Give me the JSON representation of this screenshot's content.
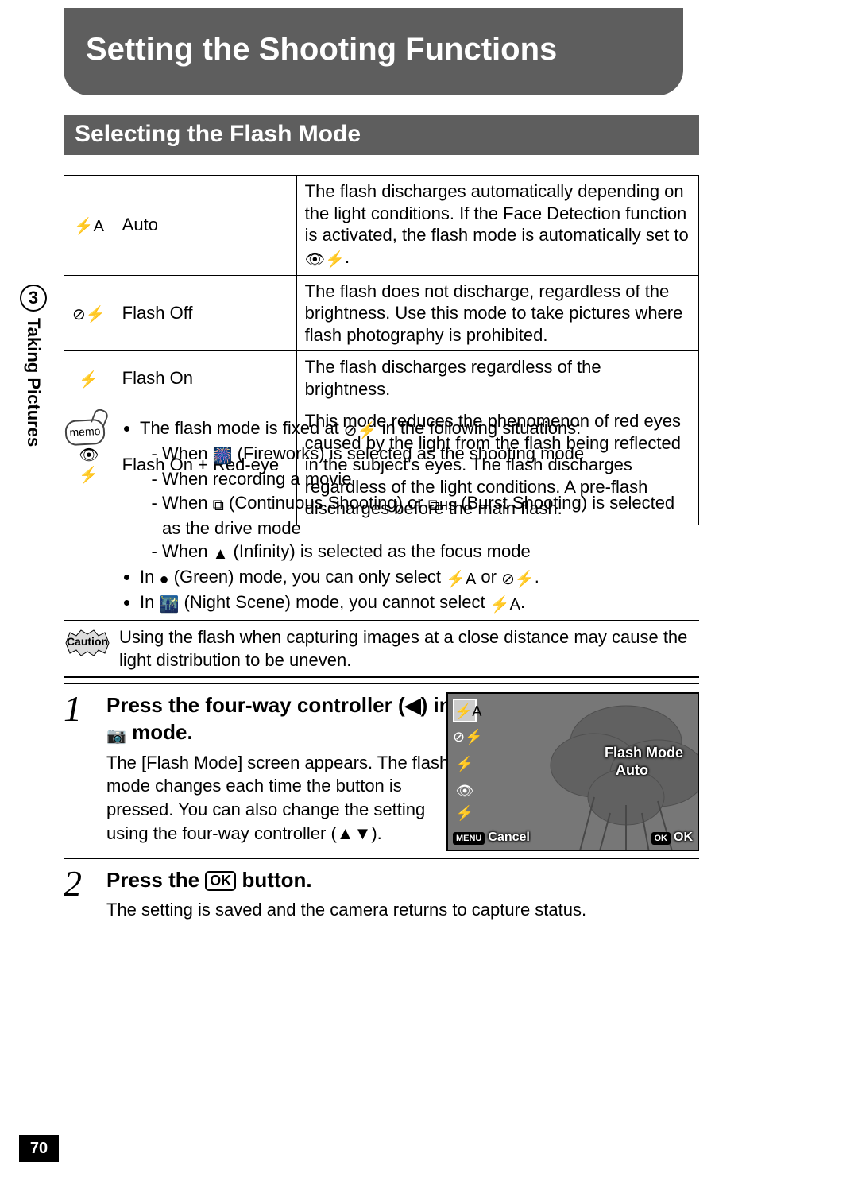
{
  "page": {
    "number": "70",
    "chapter_num": "3",
    "chapter_label": "Taking Pictures",
    "title": "Setting the Shooting Functions",
    "section": "Selecting the Flash Mode"
  },
  "flash_table": [
    {
      "icon": "⚡A",
      "name": "Auto",
      "desc_parts": [
        "The flash discharges automatically depending on the light conditions. If the Face Detection function is activated, the flash mode is automatically set to ",
        "👁⚡",
        "."
      ]
    },
    {
      "icon": "⊘⚡",
      "name": "Flash Off",
      "desc": "The flash does not discharge, regardless of the brightness. Use this mode to take pictures where flash photography is prohibited."
    },
    {
      "icon": "⚡",
      "name": "Flash On",
      "desc": "The flash discharges regardless of the brightness."
    },
    {
      "icon": "👁⚡",
      "name": "Flash On + Red-eye",
      "desc": "This mode reduces the phenomenon of red eyes caused by the light from the flash being reflected in the subject's eyes. The flash discharges regardless of the light conditions. A pre-flash discharges before the main flash."
    }
  ],
  "memo": {
    "badge": "memo",
    "b1_pre": "The flash mode is fixed at ",
    "b1_icon": "⊘⚡",
    "b1_post": " in the following situations:",
    "s1_pre": "When ",
    "s1_icon": "🎆",
    "s1_post": " (Fireworks) is selected as the shooting mode",
    "s2": "When recording a movie",
    "s3_pre": "When ",
    "s3_icon1": "⧉",
    "s3_mid": " (Continuous Shooting) or ",
    "s3_icon2": "⧉ʜs",
    "s3_post": " (Burst Shooting) is selected as the drive mode",
    "s4_pre": "When ",
    "s4_icon": "▲",
    "s4_post": " (Infinity) is selected as the focus mode",
    "b2_pre": "In ",
    "b2_icon": "●",
    "b2_mid": " (Green) mode, you can only select ",
    "b2_a": "⚡A",
    "b2_or": " or ",
    "b2_b": "⊘⚡",
    "b2_end": ".",
    "b3_pre": "In ",
    "b3_icon": "🌃",
    "b3_mid": " (Night Scene) mode, you cannot select ",
    "b3_a": "⚡A",
    "b3_end": "."
  },
  "caution": {
    "badge": "Caution",
    "text": "Using the flash when capturing images at a close distance may cause the light distribution to be uneven."
  },
  "steps": {
    "s1": {
      "num": "1",
      "title_pre": "Press the four-way controller (",
      "title_arrow": "◀",
      "title_mid": ") in ",
      "title_icon": "📷",
      "title_post": " mode.",
      "body_pre": "The [Flash Mode] screen appears. The flash mode changes each time the button is pressed. You can also change the setting using the four-way controller (",
      "body_arrows": "▲▼",
      "body_post": ")."
    },
    "s2": {
      "num": "2",
      "title_pre": "Press the ",
      "title_ok": "OK",
      "title_post": " button.",
      "body": "The setting is saved and the camera returns to capture status."
    }
  },
  "lcd": {
    "icons": [
      "⚡A",
      "⊘⚡",
      "⚡",
      "👁⚡"
    ],
    "title": "Flash Mode",
    "value": "Auto",
    "menu": "MENU",
    "cancel": "Cancel",
    "ok_box": "OK",
    "ok_label": "OK"
  }
}
